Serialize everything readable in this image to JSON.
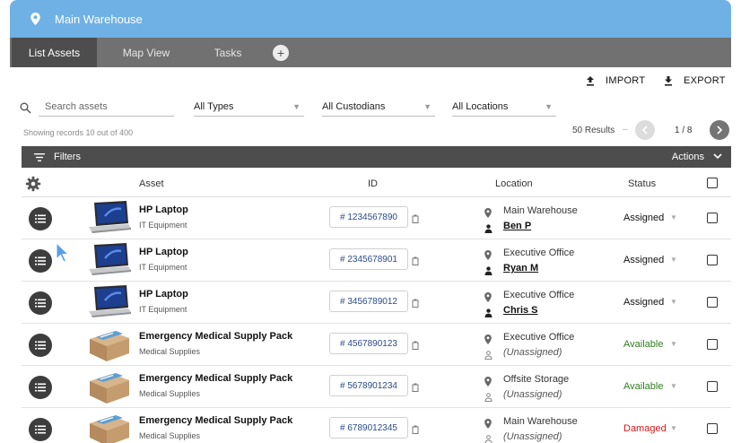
{
  "header": {
    "title": "Main Warehouse",
    "icon": "location-pin-icon",
    "color": "#6fb1e4"
  },
  "tabs": [
    {
      "label": "List Assets",
      "active": true
    },
    {
      "label": "Map View",
      "active": false
    },
    {
      "label": "Tasks",
      "active": false
    }
  ],
  "tab_add_label": "+",
  "toolbar": {
    "import_label": "IMPORT",
    "export_label": "EXPORT"
  },
  "filters": {
    "search_placeholder": "Search assets",
    "types": "All Types",
    "custodians": "All Custodians",
    "locations": "All Locations"
  },
  "summary": {
    "showing": "Showing records 10 out of 400",
    "results": "50 Results",
    "page": "1 / 8"
  },
  "filterbar": {
    "label": "Filters",
    "actions": "Actions"
  },
  "table": {
    "headers": {
      "asset": "Asset",
      "id": "ID",
      "location": "Location",
      "status": "Status"
    },
    "rows": [
      {
        "name": "HP Laptop",
        "type": "IT Equipment",
        "id": "# 1234567890",
        "location": "Main Warehouse",
        "custodian": "Ben P",
        "assigned": true,
        "status": "Assigned",
        "status_kind": "assigned",
        "thumb": "laptop"
      },
      {
        "name": "HP Laptop",
        "type": "IT Equipment",
        "id": "# 2345678901",
        "location": "Executive Office",
        "custodian": "Ryan M",
        "assigned": true,
        "status": "Assigned",
        "status_kind": "assigned",
        "thumb": "laptop"
      },
      {
        "name": "HP Laptop",
        "type": "IT Equipment",
        "id": "# 3456789012",
        "location": "Executive Office",
        "custodian": "Chris S",
        "assigned": true,
        "status": "Assigned",
        "status_kind": "assigned",
        "thumb": "laptop"
      },
      {
        "name": "Emergency Medical Supply Pack",
        "type": "Medical Supplies",
        "id": "# 4567890123",
        "location": "Executive Office",
        "custodian": "(Unassigned)",
        "assigned": false,
        "status": "Available",
        "status_kind": "available",
        "thumb": "box"
      },
      {
        "name": "Emergency Medical Supply Pack",
        "type": "Medical Supplies",
        "id": "# 5678901234",
        "location": "Offsite Storage",
        "custodian": "(Unassigned)",
        "assigned": false,
        "status": "Available",
        "status_kind": "available",
        "thumb": "box"
      },
      {
        "name": "Emergency Medical Supply Pack",
        "type": "Medical Supplies",
        "id": "# 6789012345",
        "location": "Main Warehouse",
        "custodian": "(Unassigned)",
        "assigned": false,
        "status": "Damaged",
        "status_kind": "damaged",
        "thumb": "box"
      }
    ]
  },
  "colors": {
    "assigned": "#111111",
    "available": "#2f7d1f",
    "damaged": "#d31a1a"
  }
}
